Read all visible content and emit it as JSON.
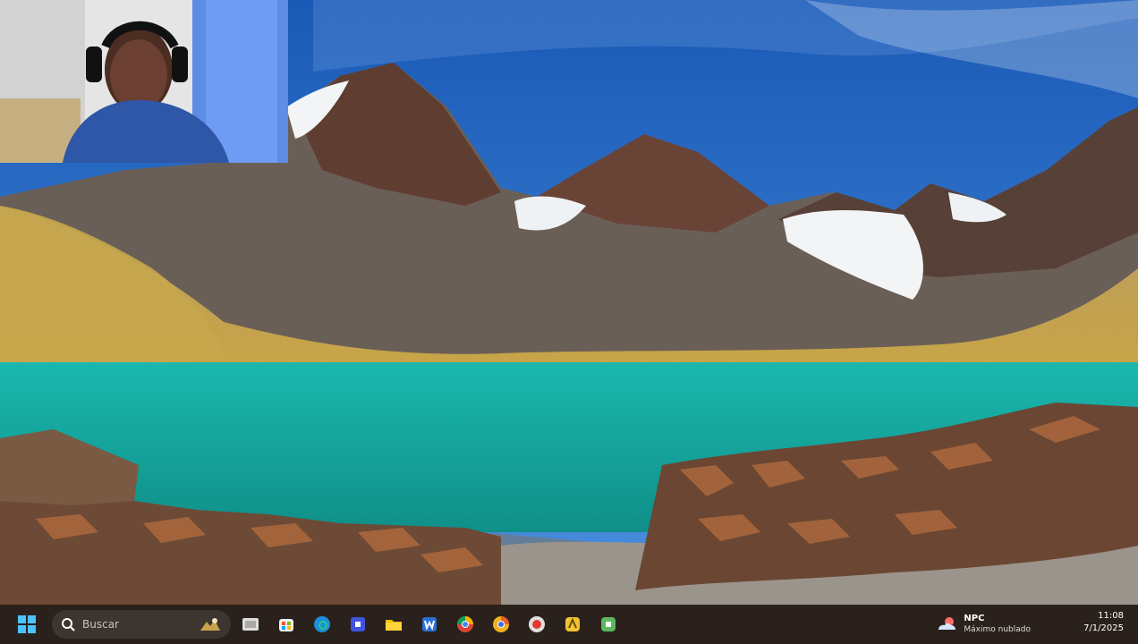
{
  "desktop": {
    "wallpaper_subject": "mountain lake landscape"
  },
  "webcam": {
    "present": true
  },
  "taskbar": {
    "search_label": "Buscar",
    "apps": [
      {
        "name": "task-view",
        "icon": "task-view-icon"
      },
      {
        "name": "microsoft-store",
        "icon": "store-icon"
      },
      {
        "name": "edge",
        "icon": "edge-icon"
      },
      {
        "name": "app-blue",
        "icon": "app-icon"
      },
      {
        "name": "file-explorer",
        "icon": "folder-icon"
      },
      {
        "name": "word",
        "icon": "word-icon"
      },
      {
        "name": "chrome",
        "icon": "chrome-icon"
      },
      {
        "name": "chrome-canary",
        "icon": "chrome-canary-icon"
      },
      {
        "name": "app-red",
        "icon": "recorder-icon"
      },
      {
        "name": "app-yellow",
        "icon": "app-icon"
      },
      {
        "name": "app-green",
        "icon": "app-icon"
      }
    ],
    "weather": {
      "temp": "NPC",
      "desc": "Máximo nublado"
    },
    "clock": {
      "time": "11:08",
      "date": "7/1/2025"
    }
  },
  "colors": {
    "taskbar_bg": "#2a211c",
    "lake": "#16b1a8",
    "sky": "#1b5fb8"
  }
}
